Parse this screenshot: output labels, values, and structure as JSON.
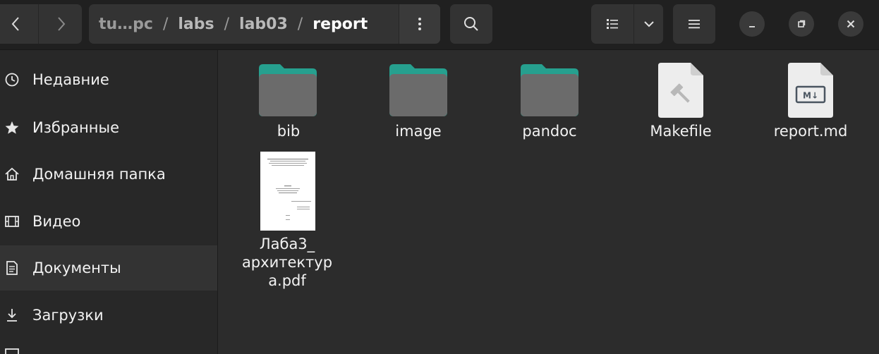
{
  "header": {
    "path": [
      "tu…pc",
      "labs",
      "lab03",
      "report"
    ],
    "path_separator": "/"
  },
  "sidebar": {
    "items": [
      {
        "label": "Недавние",
        "icon": "clock-icon"
      },
      {
        "label": "Избранные",
        "icon": "star-icon"
      },
      {
        "label": "Домашняя папка",
        "icon": "home-icon"
      },
      {
        "label": "Видео",
        "icon": "film-icon"
      },
      {
        "label": "Документы",
        "icon": "document-icon"
      },
      {
        "label": "Загрузки",
        "icon": "download-icon"
      }
    ],
    "active_index": 4
  },
  "files": [
    {
      "name": "bib",
      "type": "folder"
    },
    {
      "name": "image",
      "type": "folder"
    },
    {
      "name": "pandoc",
      "type": "folder"
    },
    {
      "name": "Makefile",
      "type": "makefile"
    },
    {
      "name": "report.md",
      "type": "markdown"
    },
    {
      "name_lines": [
        "Лаба3_",
        "архитектур",
        "a.pdf"
      ],
      "type": "pdf"
    }
  ],
  "icons": {
    "markdown_badge": "M↓"
  },
  "colors": {
    "folder_tab": "#26a08f",
    "folder_body": "#6b6b6b",
    "window_bg": "#2c2c2c"
  }
}
